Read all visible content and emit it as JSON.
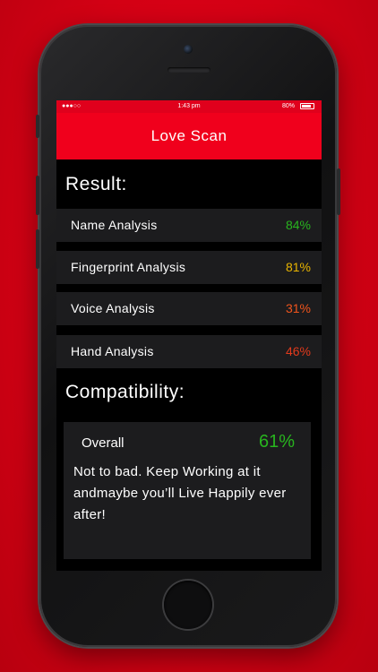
{
  "status_bar": {
    "signal": "●●●○○",
    "time": "1:43 pm",
    "battery": "80%"
  },
  "nav": {
    "title": "Love Scan"
  },
  "result": {
    "heading": "Result:",
    "items": [
      {
        "label": "Name Analysis",
        "value": "84%",
        "color": "#28b41e"
      },
      {
        "label": "Fingerprint Analysis",
        "value": "81%",
        "color": "#e8b400"
      },
      {
        "label": "Voice Analysis",
        "value": "31%",
        "color": "#f0541c"
      },
      {
        "label": "Hand Analysis",
        "value": "46%",
        "color": "#e23a1c"
      }
    ]
  },
  "compatibility": {
    "heading": "Compatibility:",
    "overall_label": "Overall",
    "overall_value": "61%",
    "overall_color": "#28b41e",
    "message": "Not to bad. Keep Working at it andmaybe you’ll Live Happily ever after!"
  },
  "colors": {
    "accent": "#f0001c",
    "background": "#d30014",
    "row_bg": "#1c1c1e"
  }
}
